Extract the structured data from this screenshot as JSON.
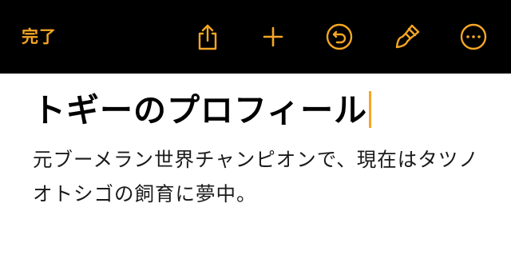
{
  "toolbar": {
    "done_label": "完了",
    "icons": [
      "share-icon",
      "add-icon",
      "undo-icon",
      "format-brush-icon",
      "more-icon"
    ]
  },
  "document": {
    "title": "トギーのプロフィール",
    "body": "元ブーメラン世界チャンピオンで、現在はタツノオトシゴの飼育に夢中。"
  },
  "colors": {
    "accent": "#f5a623",
    "toolbar_bg": "#000000",
    "page_bg": "#ffffff",
    "text": "#000000"
  }
}
